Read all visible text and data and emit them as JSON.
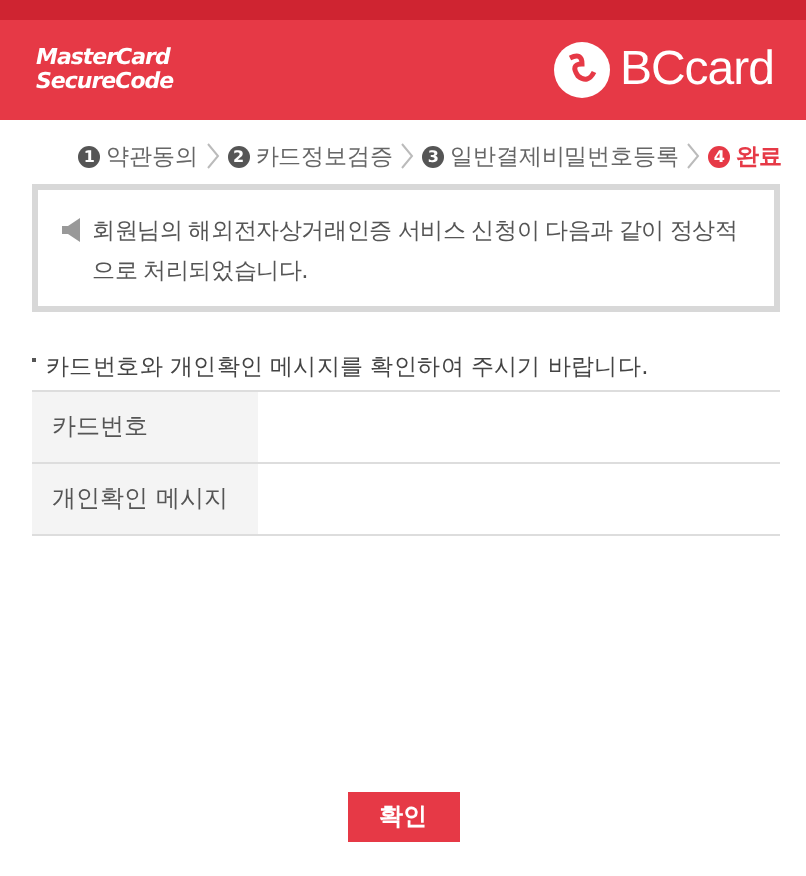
{
  "header": {
    "left_logo": [
      "MasterCard",
      "SecureCode"
    ],
    "right_logo": "BCcard"
  },
  "steps": [
    {
      "number": "1",
      "label": "약관동의",
      "selected": false
    },
    {
      "number": "2",
      "label": "카드정보검증",
      "selected": false
    },
    {
      "number": "3",
      "label": "일반결제비밀번호등록",
      "selected": false
    },
    {
      "number": "4",
      "label": "완료",
      "selected": true
    }
  ],
  "notice": "회원님의 해외전자상거래인증 서비스 신청이 다음과 같이 정상적으로 처리되었습니다.",
  "instruction": "카드번호와 개인확인 메시지를 확인하여 주시기 바랍니다.",
  "table": {
    "rows": [
      {
        "label": "카드번호"
      },
      {
        "label": "개인확인 메시지"
      }
    ]
  },
  "buttons": [
    "확인"
  ]
}
